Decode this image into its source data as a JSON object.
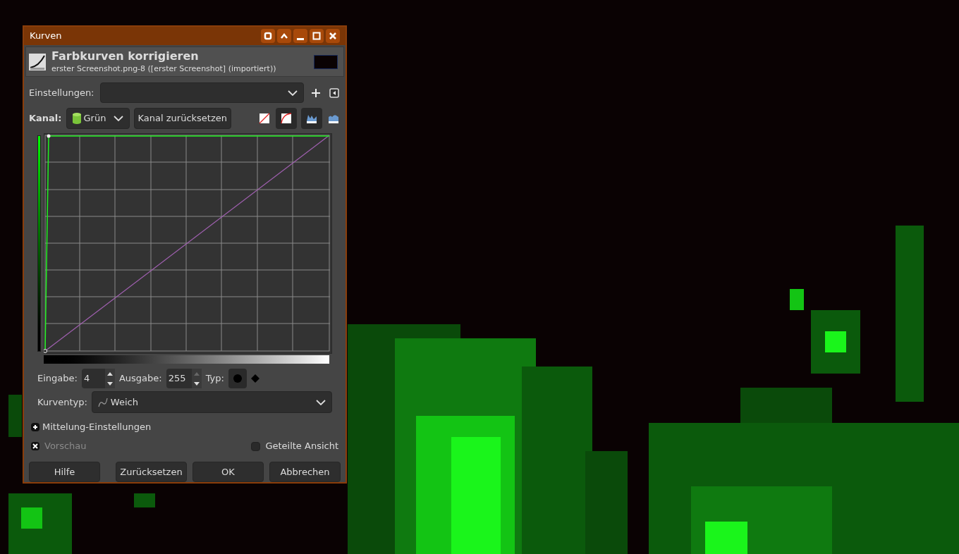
{
  "window": {
    "title": "Kurven"
  },
  "header": {
    "title": "Farbkurven korrigieren",
    "subtitle": "erster Screenshot.png-8 ([erster Screenshot] (importiert))"
  },
  "settings": {
    "label": "Einstellungen:"
  },
  "channel": {
    "label": "Kanal:",
    "value": "Grün",
    "reset_button": "Kanal zurücksetzen"
  },
  "view_toggles": [
    {
      "kind": "linear",
      "selected": false
    },
    {
      "kind": "log",
      "selected": true
    },
    {
      "kind": "hist-linear",
      "selected": true
    },
    {
      "kind": "hist-log",
      "selected": false
    }
  ],
  "point": {
    "input_label": "Eingabe:",
    "input": "4",
    "output_label": "Ausgabe:",
    "output": "255",
    "type_label": "Typ:",
    "types": [
      {
        "kind": "smooth",
        "selected": true
      },
      {
        "kind": "corner",
        "selected": false
      }
    ]
  },
  "curve_type": {
    "label": "Kurventyp:",
    "value": "Weich"
  },
  "expander": {
    "label": "Mittelung-Einstellungen",
    "expanded": false
  },
  "preview": {
    "label": "Vorschau",
    "checked": true,
    "disabled": true
  },
  "split_view": {
    "label": "Geteilte Ansicht",
    "checked": false
  },
  "buttons": [
    "Hilfe",
    "Zurücksetzen",
    "OK",
    "Abbrechen"
  ]
}
